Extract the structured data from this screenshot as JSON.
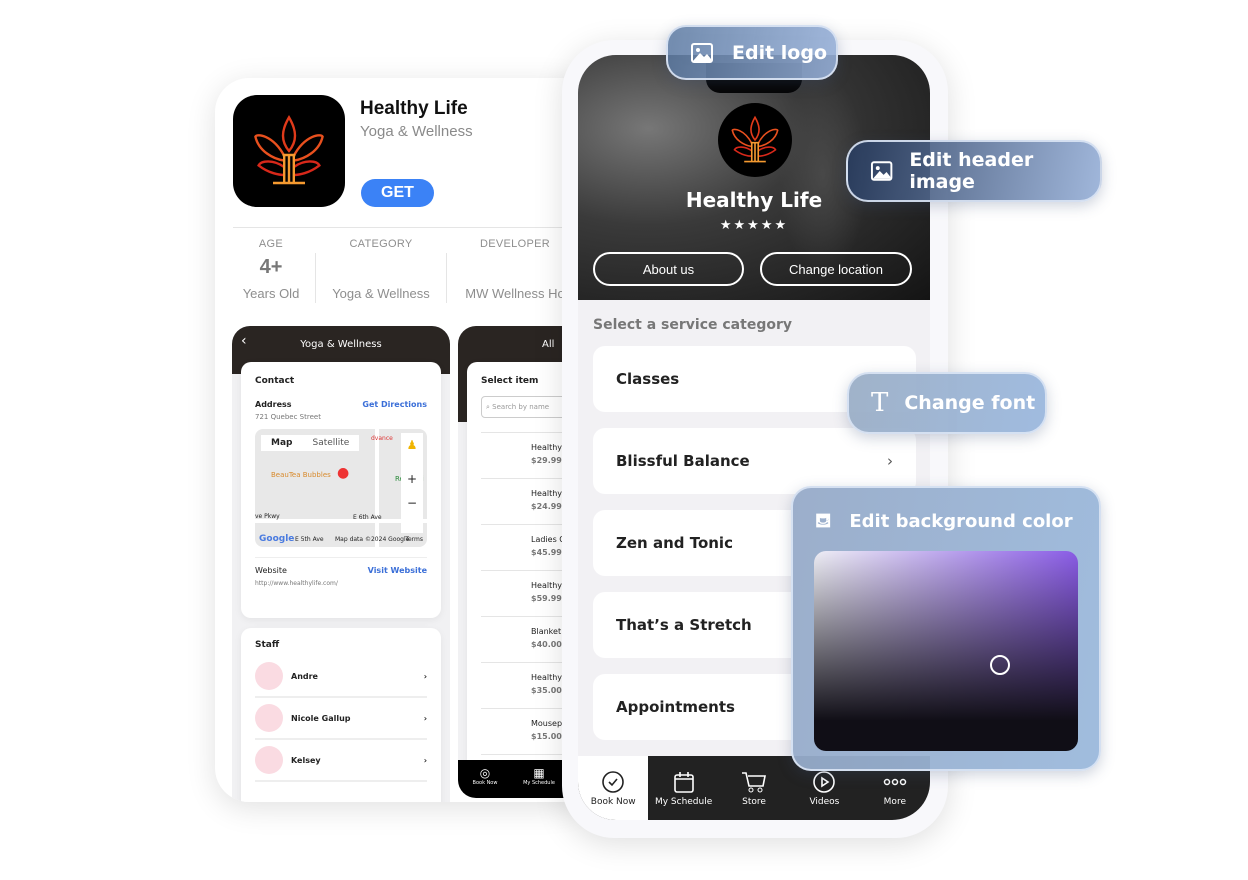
{
  "store": {
    "app_name": "Healthy Life",
    "subtitle": "Yoga & Wellness",
    "get_label": "GET",
    "stats": [
      {
        "label": "AGE",
        "value": "4+",
        "sub": "Years Old"
      },
      {
        "label": "CATEGORY",
        "value": "",
        "sub": "Yoga & Wellness"
      },
      {
        "label": "DEVELOPER",
        "value": "",
        "sub": "MW Wellness Ho"
      }
    ]
  },
  "shot1": {
    "title": "Yoga & Wellness",
    "contact_title": "Contact",
    "address_label": "Address",
    "directions": "Get Directions",
    "address": "721 Quebec Street",
    "map": {
      "tab_map": "Map",
      "tab_satellite": "Satellite",
      "place": "BeauTea Bubbles",
      "street1": "E 6th Ave",
      "street2": "ve Pkwy",
      "park": "Recreati",
      "poi": "dvance",
      "google": "Google",
      "credits": "Map data ©2024 Google",
      "terms": "Terms",
      "e5": "E 5th Ave"
    },
    "website_label": "Website",
    "visit": "Visit Website",
    "url": "http://www.healthylife.com/",
    "staff_title": "Staff",
    "staff": [
      "Andre",
      "Nicole Gallup",
      "Kelsey"
    ]
  },
  "shot2": {
    "title": "All",
    "select_item": "Select item",
    "search_placeholder": "Search by name",
    "items": [
      {
        "name": "Healthy Lif",
        "price": "$29.99"
      },
      {
        "name": "Healthy Lif",
        "price": "$24.99"
      },
      {
        "name": "Ladies Crop",
        "price": "$45.99"
      },
      {
        "name": "Healthy Lif",
        "price": "$59.99"
      },
      {
        "name": "Blanket",
        "price": "$40.00"
      },
      {
        "name": "Healthy Lif",
        "price": "$35.00"
      },
      {
        "name": "Mousepad",
        "price": "$15.00"
      }
    ],
    "tabs": [
      "Book Now",
      "My Schedule"
    ]
  },
  "phone": {
    "title": "Healthy Life",
    "rating": 5,
    "stars": "★★★★★",
    "about": "About us",
    "change_location": "Change location",
    "section": "Select a service category",
    "services": [
      "Classes",
      "Blissful Balance",
      "Zen and Tonic",
      "That’s a Stretch",
      "Appointments"
    ],
    "tabs": [
      "Book Now",
      "My Schedule",
      "Store",
      "Videos",
      "More"
    ]
  },
  "overlays": {
    "edit_logo": "Edit logo",
    "edit_header": "Edit header image",
    "change_font": "Change font",
    "edit_bg": "Edit background color"
  },
  "colors": {
    "accent": "#3b82f6",
    "picker_hue": "#8a5ce6",
    "tabbar": "#222222"
  }
}
